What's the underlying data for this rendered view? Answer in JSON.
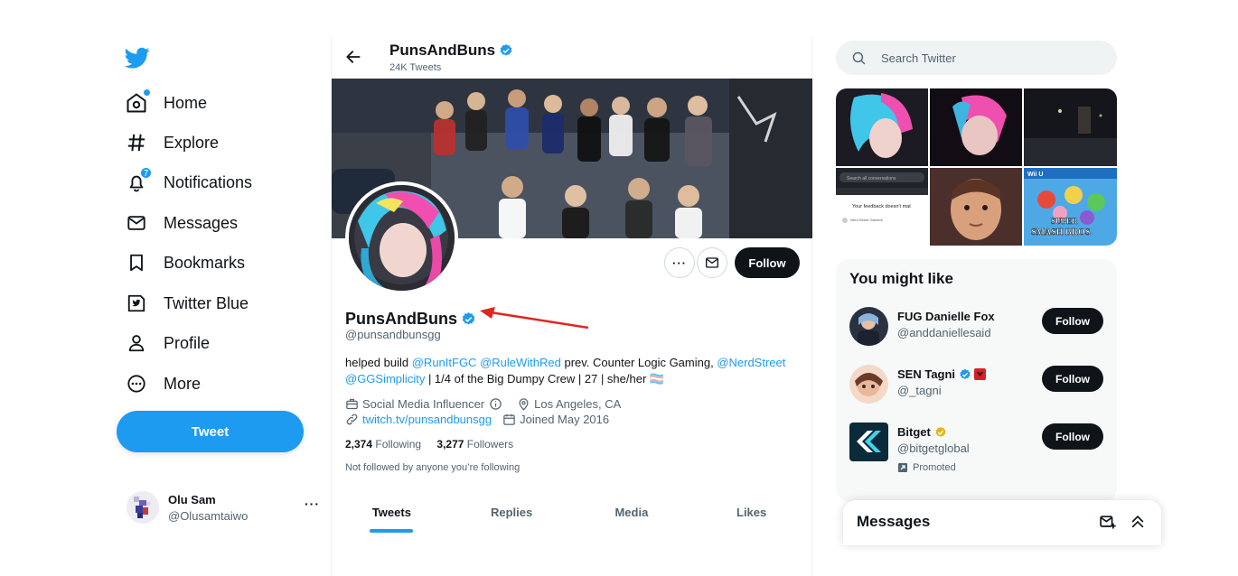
{
  "nav": {
    "items": [
      {
        "label": "Home",
        "icon": "home-icon"
      },
      {
        "label": "Explore",
        "icon": "hashtag-icon"
      },
      {
        "label": "Notifications",
        "icon": "bell-icon",
        "badge": "7"
      },
      {
        "label": "Messages",
        "icon": "envelope-icon"
      },
      {
        "label": "Bookmarks",
        "icon": "bookmark-icon"
      },
      {
        "label": "Twitter Blue",
        "icon": "twitter-blue-icon"
      },
      {
        "label": "Profile",
        "icon": "person-icon"
      },
      {
        "label": "More",
        "icon": "more-circle-icon"
      }
    ],
    "tweet_button": "Tweet",
    "account": {
      "name": "Olu Sam",
      "handle": "@Olusamtaiwo",
      "more": "···"
    }
  },
  "profile": {
    "top_name": "PunsAndBuns",
    "tweet_count": "24K Tweets",
    "name": "PunsAndBuns",
    "handle": "@punsandbunsgg",
    "follow_label": "Follow",
    "more_label": "···",
    "bio": {
      "p1": "helped build ",
      "m1": "@RunItFGC",
      "p2": " ",
      "m2": "@RuleWithRed",
      "p3": " prev. Counter Logic Gaming, ",
      "m3": "@NerdStreet",
      "p4": " ",
      "m4": "@GGSimplicity",
      "p5": " | 1/4 of the Big Dumpy Crew | 27 | she/her 🏳️‍⚧️"
    },
    "category": "Social Media Influencer",
    "location": "Los Angeles, CA",
    "website": "twitch.tv/punsandbunsgg",
    "joined": "Joined May 2016",
    "following_count": "2,374",
    "following_label": "Following",
    "followers_count": "3,277",
    "followers_label": "Followers",
    "not_followed": "Not followed by anyone you’re following",
    "tabs": [
      "Tweets",
      "Replies",
      "Media",
      "Likes"
    ]
  },
  "search": {
    "placeholder": "Search Twitter"
  },
  "who_to_follow": {
    "title": "You might like",
    "accounts": [
      {
        "name": "FUG Danielle Fox",
        "handle": "@anddaniellesaid",
        "button": "Follow"
      },
      {
        "name": "SEN Tagni",
        "handle": "@_tagni",
        "button": "Follow"
      },
      {
        "name": "Bitget",
        "handle": "@bitgetglobal",
        "button": "Follow",
        "promoted": "Promoted"
      }
    ]
  },
  "messages_drawer": {
    "title": "Messages"
  },
  "media_thumbs": {
    "t4_search": "Search all conversations",
    "t4_text": "Your feedback doesn't mat",
    "t4_sub": "Nerd Street Gamers",
    "t6_brand": "Wii U",
    "t6_title1": "SUPER",
    "t6_title2": "SMASH BROS."
  },
  "colors": {
    "accent": "#1d9bf0",
    "text": "#0f1419",
    "muted": "#536471",
    "arrow": "#e0261f",
    "gold": "#e2b719"
  }
}
